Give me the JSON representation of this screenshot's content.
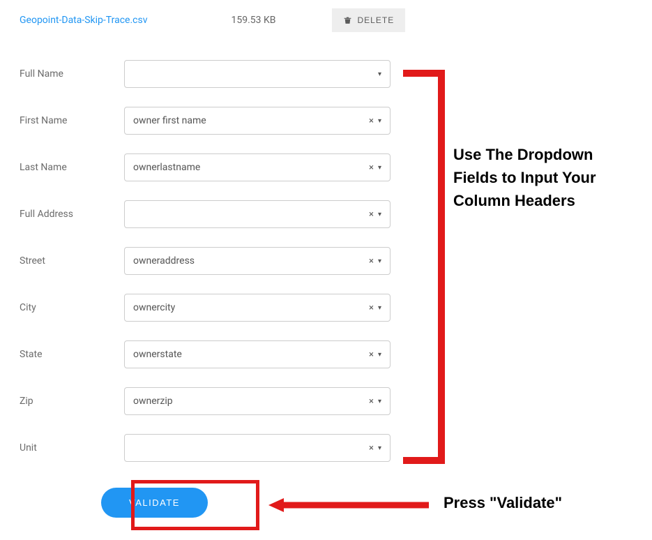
{
  "file": {
    "name": "Geopoint-Data-Skip-Trace.csv",
    "size": "159.53 KB",
    "delete_label": "DELETE"
  },
  "fields": [
    {
      "label": "Full Name",
      "value": "",
      "clearable": false
    },
    {
      "label": "First Name",
      "value": "owner first name",
      "clearable": true
    },
    {
      "label": "Last Name",
      "value": "ownerlastname",
      "clearable": true
    },
    {
      "label": "Full Address",
      "value": "",
      "clearable": true
    },
    {
      "label": "Street",
      "value": "owneraddress",
      "clearable": true
    },
    {
      "label": "City",
      "value": "ownercity",
      "clearable": true
    },
    {
      "label": "State",
      "value": "ownerstate",
      "clearable": true
    },
    {
      "label": "Zip",
      "value": "ownerzip",
      "clearable": true
    },
    {
      "label": "Unit",
      "value": "",
      "clearable": true
    }
  ],
  "validate_label": "VALIDATE",
  "annotations": {
    "dropdown_note": "Use The Dropdown Fields to Input Your Column Headers",
    "press_note": "Press \"Validate\""
  }
}
